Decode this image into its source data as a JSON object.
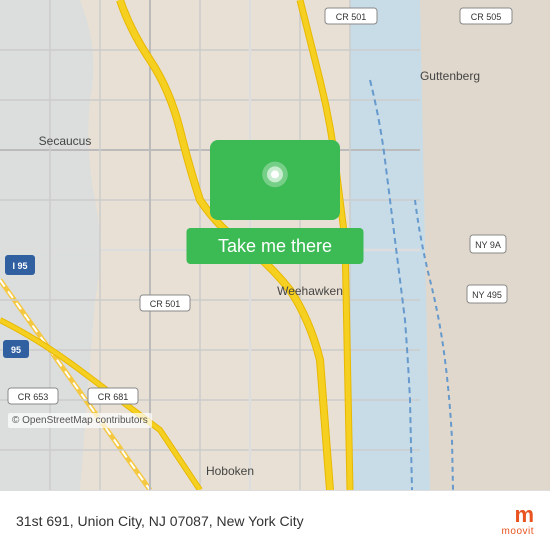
{
  "map": {
    "center_lat": 40.7682,
    "center_lon": -74.0241,
    "location": "Weehawken, NJ area",
    "osm_credit": "© OpenStreetMap contributors"
  },
  "button": {
    "label": "Take me there"
  },
  "bottom_bar": {
    "address": "31st 691, Union City, NJ 07087, New York City"
  },
  "logo": {
    "brand": "moovit",
    "m_letter": "m",
    "full_name": "moovit"
  },
  "map_labels": {
    "secaucus": "Secaucus",
    "guttenberg": "Guttenberg",
    "weehawken": "Weehawken",
    "hoboken": "Hoboken",
    "cr501_top": "CR 501",
    "cr505": "CR 505",
    "cr501_bottom": "CR 501",
    "cr681": "CR 681",
    "cr653": "CR 653",
    "i95": "I 95",
    "ny9a": "NY 9A",
    "ny495": "NY 495"
  }
}
